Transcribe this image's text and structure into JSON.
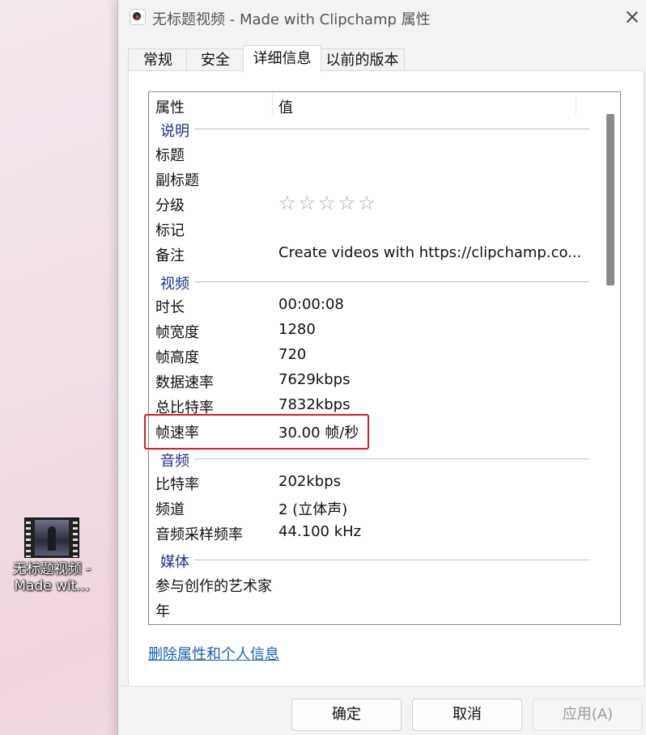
{
  "desktop": {
    "icon_label_line1": "无标题视频 -",
    "icon_label_line2": "Made wit..."
  },
  "window": {
    "title": "无标题视频 - Made with Clipchamp 属性",
    "tabs": [
      "常规",
      "安全",
      "详细信息",
      "以前的版本"
    ],
    "active_tab": "详细信息"
  },
  "details": {
    "col_property": "属性",
    "col_value": "值",
    "groups": {
      "description": "说明",
      "video": "视频",
      "audio": "音频",
      "media": "媒体"
    },
    "rows": {
      "title": {
        "k": "标题",
        "v": ""
      },
      "subtitle": {
        "k": "副标题",
        "v": ""
      },
      "rating": {
        "k": "分级",
        "v": "☆☆☆☆☆"
      },
      "tags": {
        "k": "标记",
        "v": ""
      },
      "comments": {
        "k": "备注",
        "v": "Create videos with https://clipchamp.co..."
      },
      "duration": {
        "k": "时长",
        "v": "00:00:08"
      },
      "frame_width": {
        "k": "帧宽度",
        "v": "1280"
      },
      "frame_height": {
        "k": "帧高度",
        "v": "720"
      },
      "data_rate": {
        "k": "数据速率",
        "v": "7629kbps"
      },
      "total_bitrate": {
        "k": "总比特率",
        "v": "7832kbps"
      },
      "frame_rate": {
        "k": "帧速率",
        "v": "30.00 帧/秒"
      },
      "audio_bitrate": {
        "k": "比特率",
        "v": "202kbps"
      },
      "channels": {
        "k": "频道",
        "v": "2 (立体声)"
      },
      "sample_rate": {
        "k": "音频采样频率",
        "v": "44.100 kHz"
      },
      "contributing_artists": {
        "k": "参与创作的艺术家",
        "v": ""
      },
      "year": {
        "k": "年",
        "v": ""
      }
    }
  },
  "link": "删除属性和个人信息",
  "buttons": {
    "ok": "确定",
    "cancel": "取消",
    "apply": "应用(A)"
  },
  "colors": {
    "highlight": "#e0191e",
    "group_label": "#1e3287",
    "link": "#1a5fb4"
  }
}
